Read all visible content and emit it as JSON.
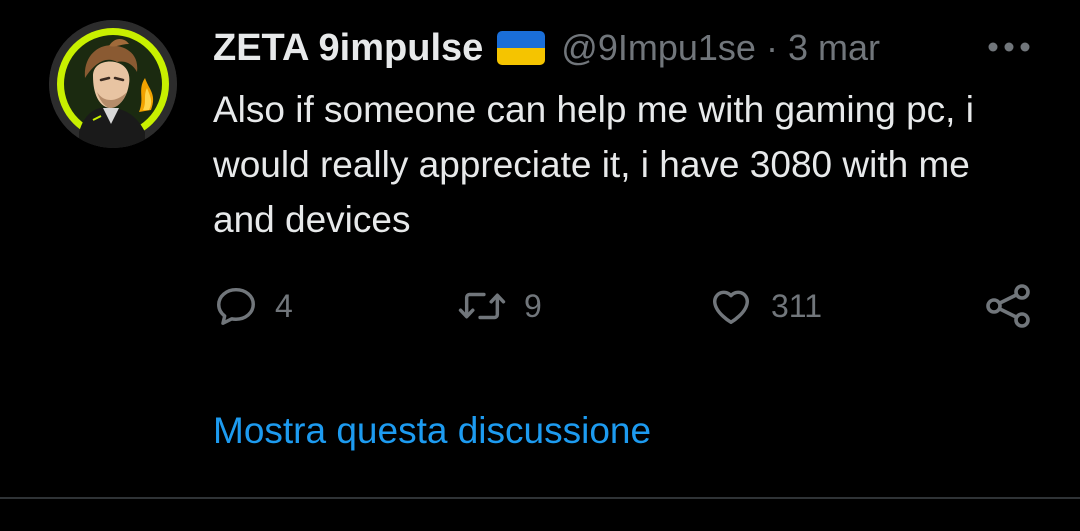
{
  "tweet": {
    "display_name": "ZETA 9impulse",
    "handle": "@9Impu1se",
    "separator": "·",
    "timestamp": "3 mar",
    "text": "Also if someone can help me with gaming pc, i would really appreciate it, i have 3080 with me and devices",
    "flag": {
      "icon": "ukraine-flag-icon",
      "top_color": "#1a6ed8",
      "bottom_color": "#f5c400"
    },
    "avatar": {
      "icon": "profile-avatar-illustration",
      "ring_color": "#c8f000"
    }
  },
  "actions": {
    "reply": {
      "icon": "reply-icon",
      "count": "4"
    },
    "retweet": {
      "icon": "retweet-icon",
      "count": "9"
    },
    "like": {
      "icon": "heart-icon",
      "count": "311"
    },
    "share": {
      "icon": "share-icon"
    },
    "more": {
      "icon": "more-options-icon"
    }
  },
  "show_thread_label": "Mostra questa discussione",
  "colors": {
    "background": "#000000",
    "primary_text": "#e7e9ea",
    "secondary_text": "#71767b",
    "link": "#1d9bf0",
    "divider": "#2f3336"
  }
}
